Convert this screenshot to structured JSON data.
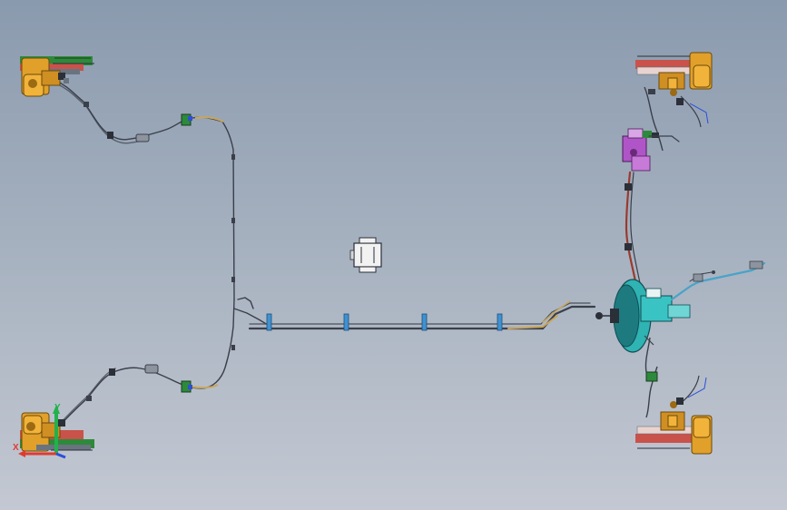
{
  "window": {
    "title": ""
  },
  "view": {
    "background_top": "#8a9aae",
    "background_bottom": "#c3c8d2"
  },
  "triad": {
    "y_label": "Y",
    "x_label": "X",
    "y_color": "#22b14c",
    "x_color": "#e03a2f",
    "z_color": "#2d4fd8"
  },
  "model": {
    "components": [
      "left-front-brake-assembly",
      "left-rear-brake-assembly",
      "right-front-brake-assembly",
      "right-rear-brake-assembly",
      "brake-booster-master-cylinder",
      "abs-control-module",
      "parking-brake-cable",
      "brake-line-harness",
      "abs-bracket"
    ],
    "colors": {
      "caliper": "#e0a02a",
      "caliper_dark": "#9b6a13",
      "rotor": "#c9524a",
      "hub": "#2e8a3a",
      "booster": "#2fb3b3",
      "booster_dark": "#1d7b80",
      "brake_line": "#3a3f4a",
      "hose_tan": "#c9a55a",
      "abs_purple": "#b055c8",
      "cable_blue": "#4aa3c8",
      "clip_blue": "#3f92d0",
      "harness_red": "#9a3a2e"
    }
  }
}
